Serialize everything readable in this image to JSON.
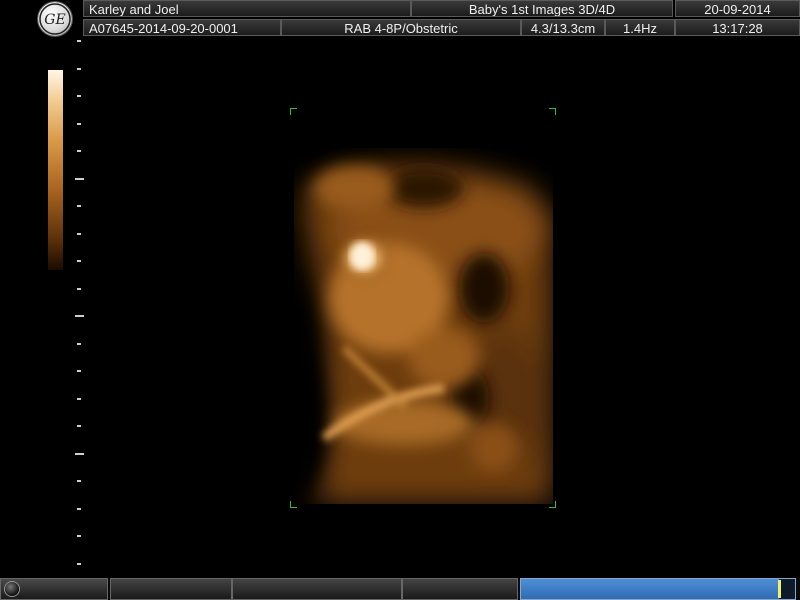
{
  "header": {
    "logo": "GE",
    "patient_name": "Karley and Joel",
    "exam_title": "Baby's 1st Images 3D/4D",
    "date": "20-09-2014",
    "exam_id": "A07645-2014-09-20-0001",
    "probe_preset": "RAB 4-8P/Obstetric",
    "depth": "4.3/13.3cm",
    "frame_rate": "1.4Hz",
    "time": "13:17:28"
  },
  "colors": {
    "accent_green": "#38c03a",
    "render_tone": "#d99a4a",
    "progress_blue": "#3c7cc4"
  },
  "icons": {
    "logo": "ge-logo-icon",
    "trackball": "trackball-icon"
  },
  "cine": {
    "progress_fraction": 0.94
  }
}
